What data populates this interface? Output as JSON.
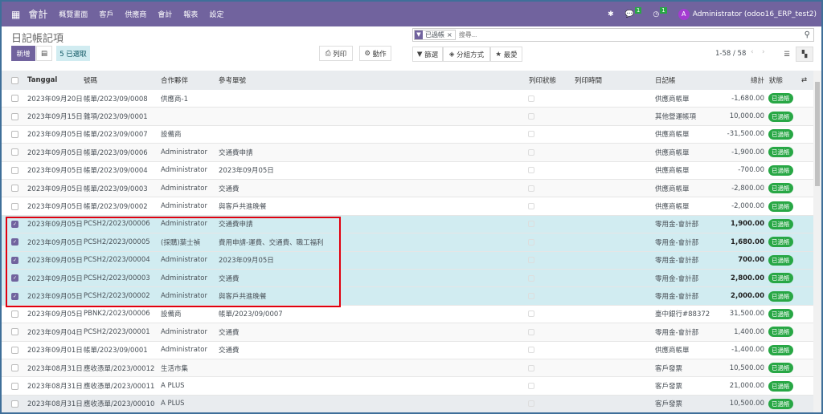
{
  "nav": {
    "app": "會計",
    "menus": [
      "概覽畫面",
      "客戶",
      "供應商",
      "會計",
      "報表",
      "設定"
    ],
    "messages_count": "1",
    "activities_count": "1",
    "avatar": "A",
    "user": "Administrator (odoo16_ERP_test2)"
  },
  "page": {
    "title": "日記帳記項",
    "new_label": "新增",
    "selected_label": "5 已選取",
    "print_label": "列印",
    "action_label": "動作"
  },
  "search": {
    "facet": "已過帳",
    "placeholder": "搜尋...",
    "filter_label": "篩選",
    "group_label": "分組方式",
    "fav_label": "最愛",
    "pager": "1-58 / 58"
  },
  "columns": {
    "date": "Tanggal",
    "number": "號碼",
    "partner": "合作夥伴",
    "ref": "參考單號",
    "print_status": "列印狀態",
    "print_time": "列印時間",
    "journal": "日記帳",
    "total": "總計",
    "state": "狀態"
  },
  "rows": [
    {
      "date": "2023年09月20日",
      "number": "帳單/2023/09/0008",
      "partner": "供應商-1",
      "ref": "",
      "journal": "供應商帳單",
      "total": "-1,680.00",
      "state": "已過帳",
      "selected": false
    },
    {
      "date": "2023年09月15日",
      "number": "雜項/2023/09/0001",
      "partner": "",
      "ref": "",
      "journal": "其他營運帳項",
      "total": "10,000.00",
      "state": "已過帳",
      "selected": false
    },
    {
      "date": "2023年09月05日",
      "number": "帳單/2023/09/0007",
      "partner": "設備商",
      "ref": "",
      "journal": "供應商帳單",
      "total": "-31,500.00",
      "state": "已過帳",
      "selected": false
    },
    {
      "date": "2023年09月05日",
      "number": "帳單/2023/09/0006",
      "partner": "Administrator",
      "ref": "交通費申請",
      "journal": "供應商帳單",
      "total": "-1,900.00",
      "state": "已過帳",
      "selected": false
    },
    {
      "date": "2023年09月05日",
      "number": "帳單/2023/09/0004",
      "partner": "Administrator",
      "ref": "2023年09月05日",
      "journal": "供應商帳單",
      "total": "-700.00",
      "state": "已過帳",
      "selected": false
    },
    {
      "date": "2023年09月05日",
      "number": "帳單/2023/09/0003",
      "partner": "Administrator",
      "ref": "交通費",
      "journal": "供應商帳單",
      "total": "-2,800.00",
      "state": "已過帳",
      "selected": false
    },
    {
      "date": "2023年09月05日",
      "number": "帳單/2023/09/0002",
      "partner": "Administrator",
      "ref": "與客戶共進晚餐",
      "journal": "供應商帳單",
      "total": "-2,000.00",
      "state": "已過帳",
      "selected": false
    },
    {
      "date": "2023年09月05日",
      "number": "PCSH2/2023/00006",
      "partner": "Administrator",
      "ref": "交通費申請",
      "journal": "零用金-會計部",
      "total": "1,900.00",
      "state": "已過帳",
      "selected": true
    },
    {
      "date": "2023年09月05日",
      "number": "PCSH2/2023/00005",
      "partner": "(採購)葉士禎",
      "ref": "費用申請-運費、交通費、職工福利",
      "journal": "零用金-會計部",
      "total": "1,680.00",
      "state": "已過帳",
      "selected": true
    },
    {
      "date": "2023年09月05日",
      "number": "PCSH2/2023/00004",
      "partner": "Administrator",
      "ref": "2023年09月05日",
      "journal": "零用金-會計部",
      "total": "700.00",
      "state": "已過帳",
      "selected": true
    },
    {
      "date": "2023年09月05日",
      "number": "PCSH2/2023/00003",
      "partner": "Administrator",
      "ref": "交通費",
      "journal": "零用金-會計部",
      "total": "2,800.00",
      "state": "已過帳",
      "selected": true
    },
    {
      "date": "2023年09月05日",
      "number": "PCSH2/2023/00002",
      "partner": "Administrator",
      "ref": "與客戶共進晚餐",
      "journal": "零用金-會計部",
      "total": "2,000.00",
      "state": "已過帳",
      "selected": true
    },
    {
      "date": "2023年09月05日",
      "number": "PBNK2/2023/00006",
      "partner": "設備商",
      "ref": "帳單/2023/09/0007",
      "journal": "臺中銀行#88372",
      "total": "31,500.00",
      "state": "已過帳",
      "selected": false
    },
    {
      "date": "2023年09月04日",
      "number": "PCSH2/2023/00001",
      "partner": "Administrator",
      "ref": "交通費",
      "journal": "零用金-會計部",
      "total": "1,400.00",
      "state": "已過帳",
      "selected": false
    },
    {
      "date": "2023年09月01日",
      "number": "帳單/2023/09/0001",
      "partner": "Administrator",
      "ref": "交通費",
      "journal": "供應商帳單",
      "total": "-1,400.00",
      "state": "已過帳",
      "selected": false
    },
    {
      "date": "2023年08月31日",
      "number": "應收憑單/2023/00012",
      "partner": "生活市集",
      "ref": "",
      "journal": "客戶發票",
      "total": "10,500.00",
      "state": "已過帳",
      "selected": false
    },
    {
      "date": "2023年08月31日",
      "number": "應收憑單/2023/00011",
      "partner": "A PLUS",
      "ref": "",
      "journal": "客戶發票",
      "total": "21,000.00",
      "state": "已過帳",
      "selected": false
    },
    {
      "date": "2023年08月31日",
      "number": "應收憑單/2023/00010",
      "partner": "A PLUS",
      "ref": "",
      "journal": "客戶發票",
      "total": "10,500.00",
      "state": "已過帳",
      "selected": false
    }
  ]
}
